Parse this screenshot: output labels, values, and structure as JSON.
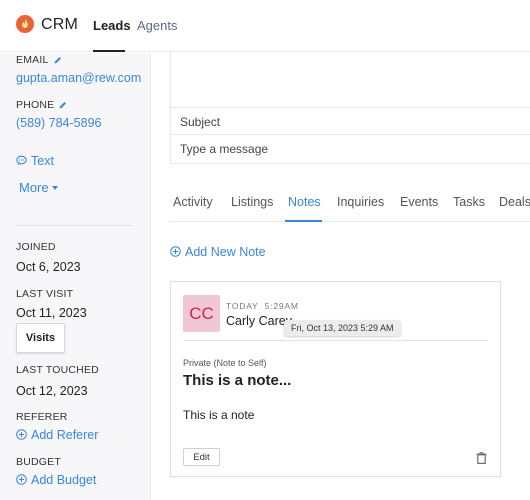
{
  "header": {
    "brand": "CRM",
    "logo_icon": "flame-icon",
    "nav": [
      {
        "label": "Leads",
        "active": true
      },
      {
        "label": "Agents",
        "active": false
      }
    ]
  },
  "sidebar": {
    "email_label": "EMAIL",
    "email_value": "gupta.aman@rew.com",
    "phone_label": "PHONE",
    "phone_value": "(589) 784-5896",
    "text_label": "Text",
    "more_label": "More",
    "joined_label": "JOINED",
    "joined_value": "Oct 6, 2023",
    "last_visit_label": "LAST VISIT",
    "last_visit_value": "Oct 11, 2023",
    "visits_button": "Visits",
    "last_touched_label": "LAST TOUCHED",
    "last_touched_value": "Oct 12, 2023",
    "referer_label": "REFERER",
    "add_referer": "Add Referer",
    "budget_label": "BUDGET",
    "add_budget": "Add Budget"
  },
  "compose": {
    "subject_placeholder": "Subject",
    "message_placeholder": "Type a message"
  },
  "tabs": [
    {
      "label": "Activity",
      "active": false
    },
    {
      "label": "Listings",
      "active": false
    },
    {
      "label": "Notes",
      "active": true
    },
    {
      "label": "Inquiries",
      "active": false
    },
    {
      "label": "Events",
      "active": false
    },
    {
      "label": "Tasks",
      "active": false
    },
    {
      "label": "Deals",
      "active": false
    }
  ],
  "notes": {
    "add_new_note": "Add New Note",
    "items": [
      {
        "avatar_initials": "CC",
        "time": "TODAY  5:29AM",
        "author": "Carly Carey",
        "tooltip": "Fri, Oct 13, 2023 5:29 AM",
        "privacy": "Private (Note to Self)",
        "title": "This is a note...",
        "body": "This is a note",
        "edit_label": "Edit"
      }
    ]
  },
  "colors": {
    "accent": "#3a86d9",
    "avatar_bg": "#f1c7d6",
    "avatar_text": "#d3244e",
    "logo": "#e8623a"
  }
}
